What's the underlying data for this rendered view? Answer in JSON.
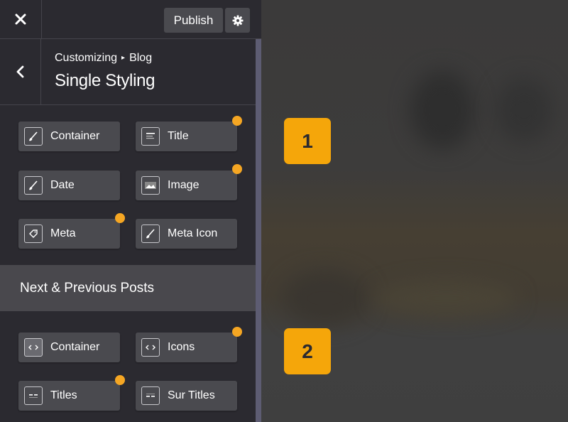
{
  "topbar": {
    "publish_label": "Publish",
    "close_icon": "close-icon",
    "gear_icon": "gear-icon"
  },
  "header": {
    "breadcrumb_parent": "Customizing",
    "breadcrumb_child": "Blog",
    "title": "Single Styling"
  },
  "single_styling_tiles": [
    {
      "label": "Container",
      "icon": "brush-icon",
      "has_dot": false
    },
    {
      "label": "Title",
      "icon": "text-lines-icon",
      "has_dot": true
    },
    {
      "label": "Date",
      "icon": "brush-icon",
      "has_dot": false
    },
    {
      "label": "Image",
      "icon": "image-icon",
      "has_dot": true
    },
    {
      "label": "Meta",
      "icon": "tag-icon",
      "has_dot": true
    },
    {
      "label": "Meta Icon",
      "icon": "brush-icon",
      "has_dot": false
    }
  ],
  "section": {
    "label": "Next & Previous Posts"
  },
  "nav_tiles": [
    {
      "label": "Container",
      "icon": "code-box-icon",
      "has_dot": false
    },
    {
      "label": "Icons",
      "icon": "code-icon",
      "has_dot": true
    },
    {
      "label": "Titles",
      "icon": "dashes-icon",
      "has_dot": true
    },
    {
      "label": "Sur Titles",
      "icon": "dashes-icon",
      "has_dot": false
    }
  ],
  "badges": [
    "1",
    "2"
  ],
  "colors": {
    "accent": "#f5a623",
    "sidebar_bg": "#2b2a30",
    "tile_bg": "#4a4a4f"
  }
}
